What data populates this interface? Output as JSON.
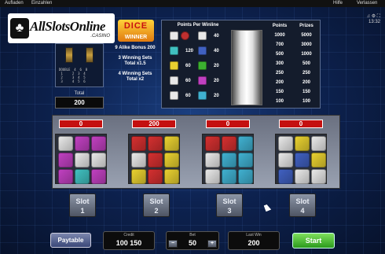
{
  "menu": {
    "left": [
      "Aufladen",
      "Einzahlen"
    ],
    "right": [
      "Hilfe",
      "Verlassen"
    ],
    "time": "13:32"
  },
  "logo": {
    "name": "AllSlotsOnline",
    "sub": ".CASINO"
  },
  "game_logo": {
    "line1": "DICE",
    "line2": "WINNER"
  },
  "mini_panel": {
    "text": "DOUBLE  4  6  8\n 1     2  3  4\n 2     3  4  5\n 3     4  5  6"
  },
  "total": {
    "label": "Total",
    "value": "200"
  },
  "bonus": [
    {
      "text": "9 Alike Bonus 200"
    },
    {
      "text": "3 Winning Sets Total x1.5"
    },
    {
      "text": "4 Winning Sets Total x2"
    }
  ],
  "points_per_win": {
    "title": "Points Per Winline",
    "left": [
      "",
      "120",
      "60",
      "60",
      "60"
    ],
    "right": [
      "40",
      "40",
      "20",
      "20",
      "20"
    ]
  },
  "points_table": {
    "headers": [
      "Points",
      "Prizes"
    ],
    "rows": [
      [
        "1000",
        "5000"
      ],
      [
        "700",
        "3000"
      ],
      [
        "500",
        "1000"
      ],
      [
        "300",
        "500"
      ],
      [
        "250",
        "250"
      ],
      [
        "200",
        "200"
      ],
      [
        "150",
        "150"
      ],
      [
        "100",
        "100"
      ]
    ]
  },
  "reels": {
    "wins": [
      "0",
      "200",
      "0",
      "0"
    ],
    "slot_labels": [
      {
        "l1": "Slot",
        "l2": "1"
      },
      {
        "l1": "Slot",
        "l2": "2"
      },
      {
        "l1": "Slot",
        "l2": "3"
      },
      {
        "l1": "Slot",
        "l2": "4"
      }
    ],
    "grid_colors": [
      [
        "#e8e8e8",
        "#c040c0",
        "#c040c0",
        "#c040c0",
        "#e8e8e8",
        "#e8e8e8",
        "#c040c0",
        "#40c0c0",
        "#c040c0"
      ],
      [
        "#d43030",
        "#d43030",
        "#e8d030",
        "#e8e8e8",
        "#d43030",
        "#e8d030",
        "#e8d030",
        "#d43030",
        "#e8d030"
      ],
      [
        "#d43030",
        "#d43030",
        "#40b0d0",
        "#e8e8e8",
        "#40b0d0",
        "#40b0d0",
        "#e8e8e8",
        "#40b0d0",
        "#40b0d0"
      ],
      [
        "#e8e8e8",
        "#e8d030",
        "#e8e8e8",
        "#e8e8e8",
        "#4060c0",
        "#e8d030",
        "#4060c0",
        "#e8e8e8",
        "#e8e8e8"
      ]
    ]
  },
  "bottom": {
    "paytable": "Paytable",
    "credit_label": "Credit",
    "credit": "100 150",
    "bet_label": "Bet",
    "bet": "50",
    "minus": "−",
    "plus": "+",
    "lastwin_label": "Last Win",
    "lastwin": "200",
    "start": "Start"
  },
  "colors": {
    "start": "#3cb82a",
    "win_box": "#c41010",
    "accent": "#ffb020"
  }
}
